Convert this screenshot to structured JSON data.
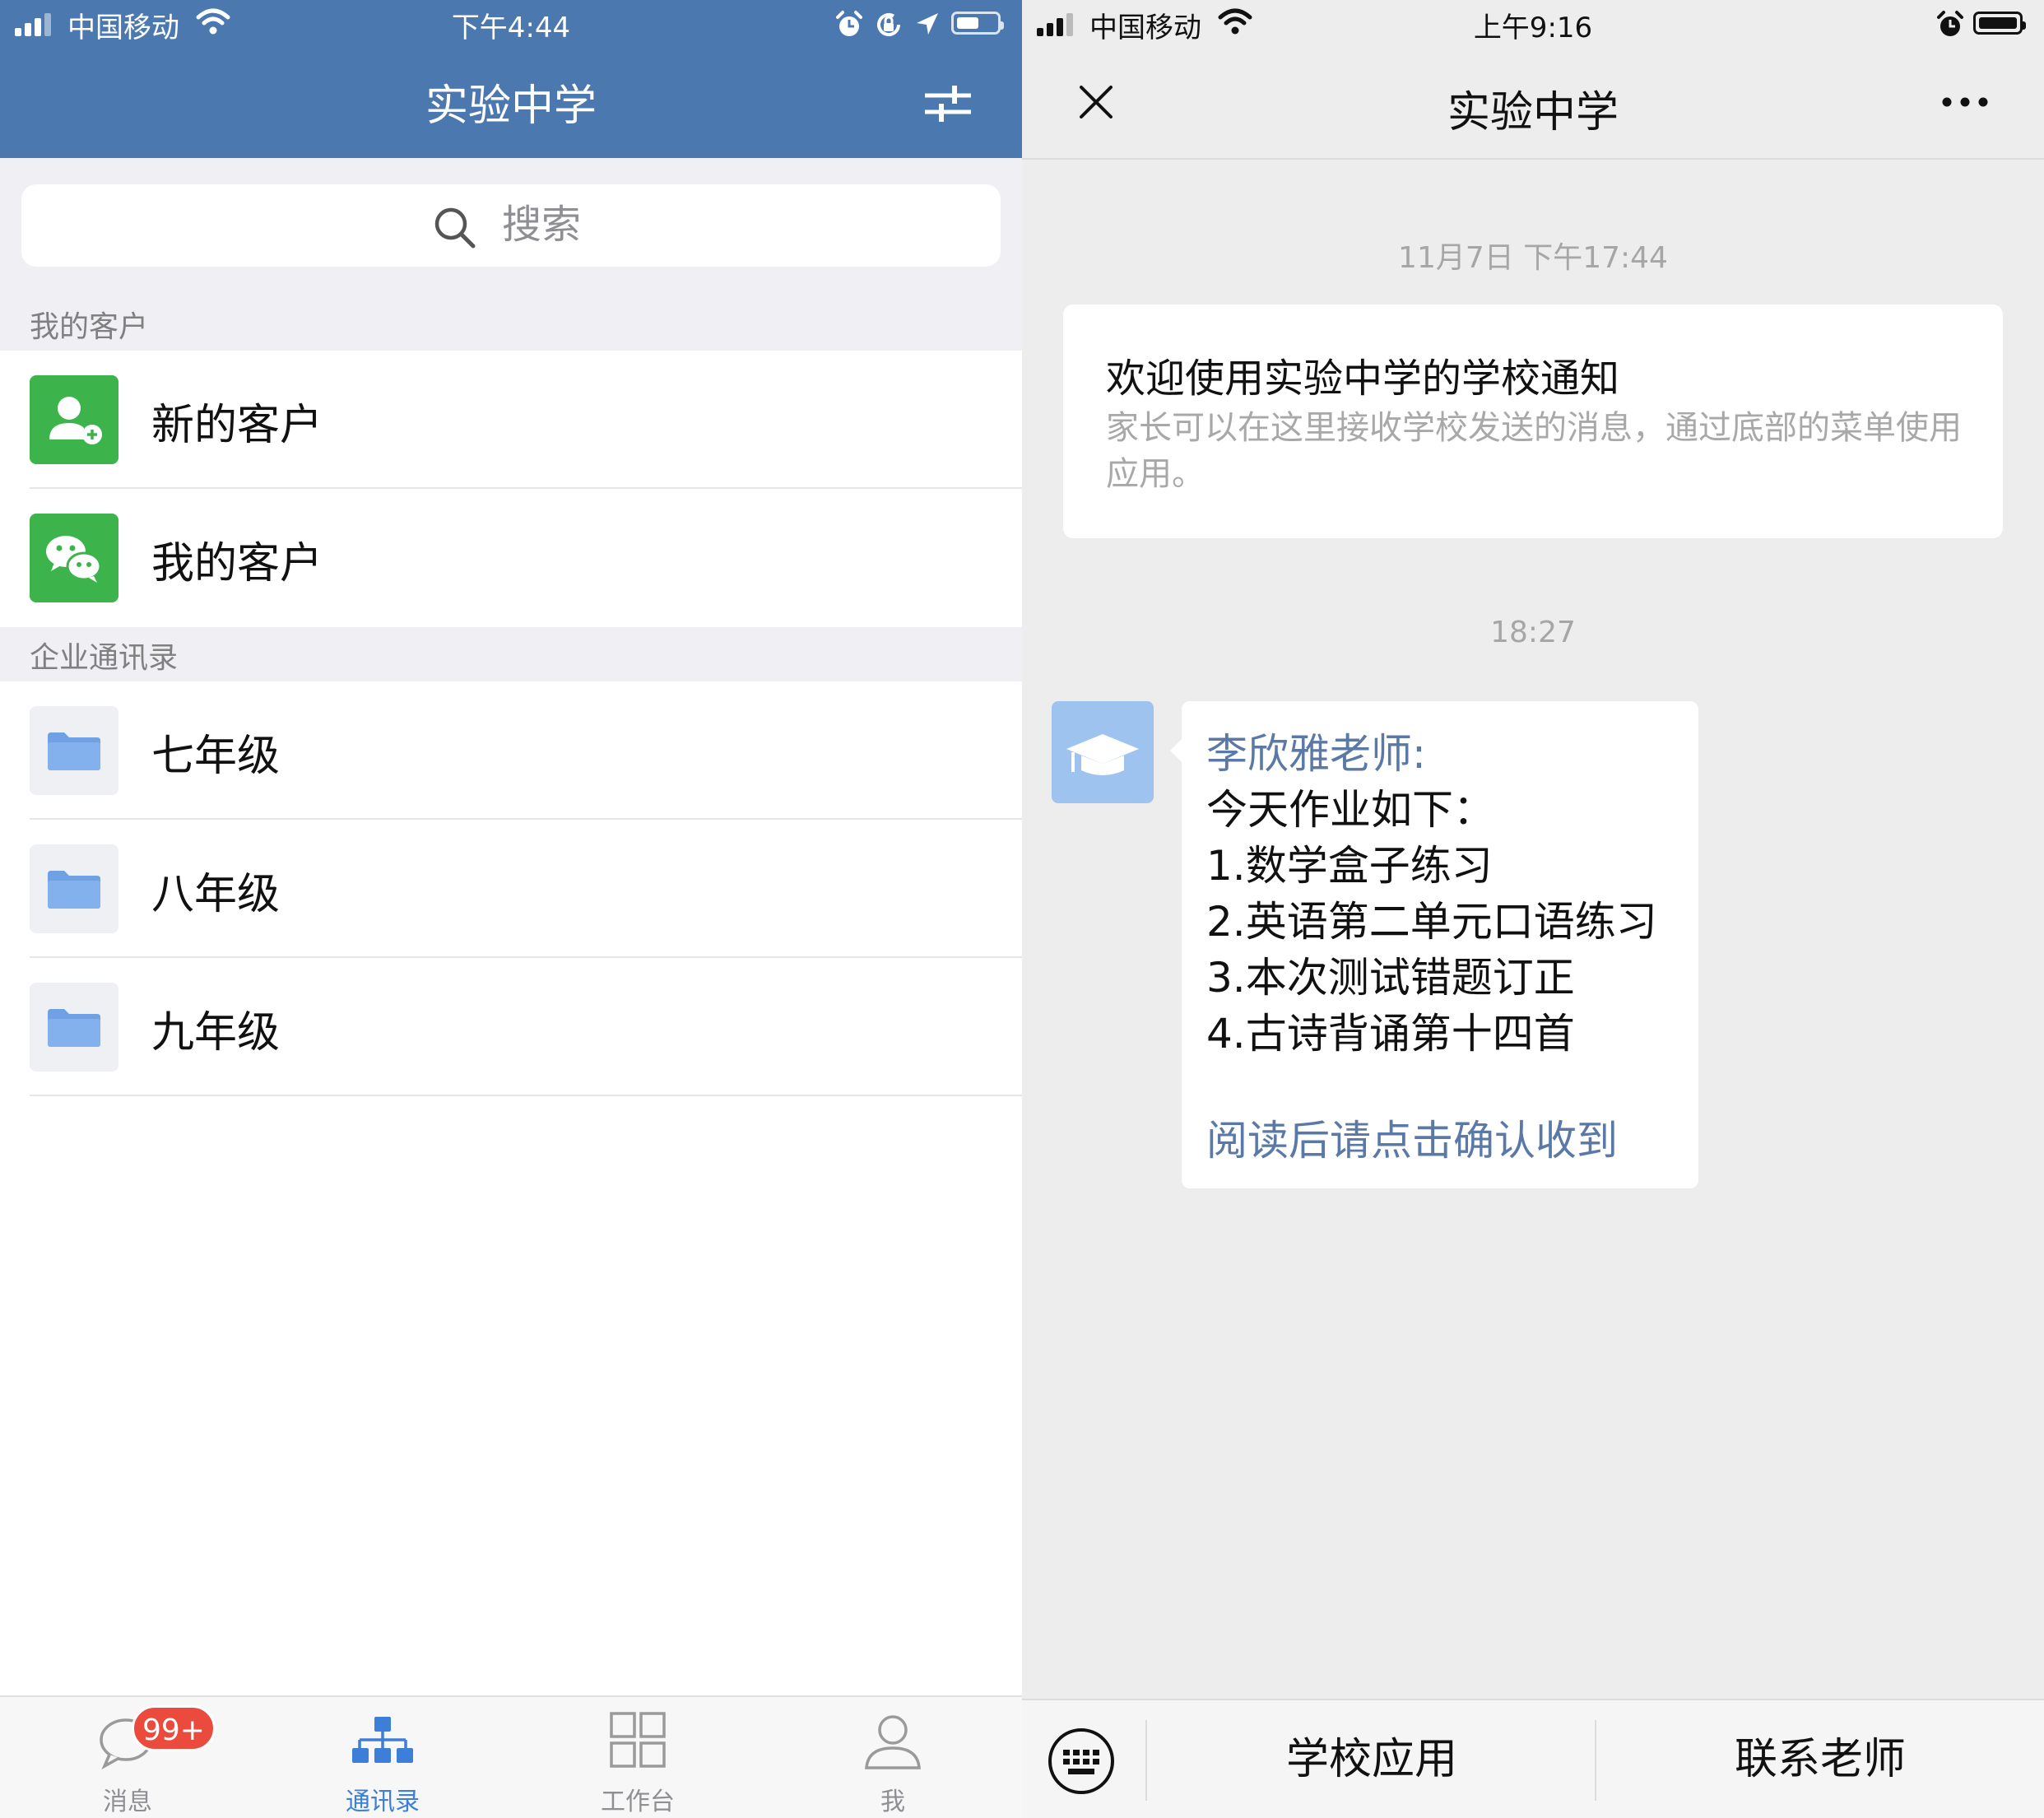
{
  "left": {
    "status": {
      "carrier": "中国移动",
      "time": "下午4:44"
    },
    "header": {
      "title": "实验中学"
    },
    "search": {
      "placeholder": "搜索"
    },
    "sections": [
      {
        "title": "我的客户"
      },
      {
        "title": "企业通讯录"
      }
    ],
    "customers": [
      {
        "label": "新的客户",
        "icon": "add-contact-icon"
      },
      {
        "label": "我的客户",
        "icon": "wechat-icon"
      }
    ],
    "directory": [
      {
        "label": "七年级",
        "icon": "folder-icon"
      },
      {
        "label": "八年级",
        "icon": "folder-icon"
      },
      {
        "label": "九年级",
        "icon": "folder-icon"
      }
    ],
    "tabs": [
      {
        "label": "消息",
        "badge": "99+",
        "icon": "chat-bubble-icon"
      },
      {
        "label": "通讯录",
        "icon": "org-chart-icon",
        "active": true
      },
      {
        "label": "工作台",
        "icon": "grid-icon"
      },
      {
        "label": "我",
        "icon": "person-icon"
      }
    ],
    "colors": {
      "header": "#4b78af",
      "accent": "#3d7ed8",
      "green": "#3cb44b",
      "badge": "#ea4b3c"
    }
  },
  "right": {
    "status": {
      "carrier": "中国移动",
      "time": "上午9:16"
    },
    "nav": {
      "title": "实验中学"
    },
    "timestamp1": "11月7日 下午17:44",
    "welcome": {
      "title": "欢迎使用实验中学的学校通知",
      "body": "家长可以在这里接收学校发送的消息，通过底部的菜单使用应用。"
    },
    "timestamp2": "18:27",
    "message": {
      "sender": "李欣雅老师:",
      "lines": [
        "今天作业如下：",
        "1.数学盒子练习",
        "2.英语第二单元口语练习",
        "3.本次测试错题订正",
        "4.古诗背诵第十四首"
      ],
      "confirm": "阅读后请点击确认收到"
    },
    "menu": [
      {
        "label": "学校应用"
      },
      {
        "label": "联系老师"
      }
    ]
  }
}
